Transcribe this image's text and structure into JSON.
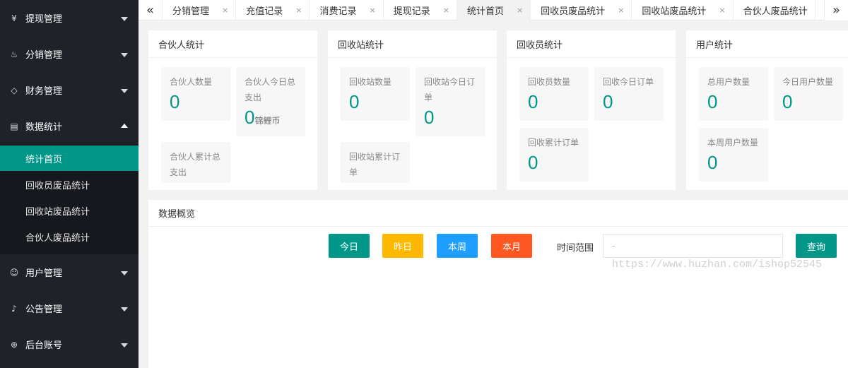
{
  "sidebar": {
    "items": [
      {
        "label": "提现管理",
        "icon": "yen-circle-icon",
        "glyph": "¥"
      },
      {
        "label": "分销管理",
        "icon": "fire-icon",
        "glyph": "♨"
      },
      {
        "label": "财务管理",
        "icon": "diamond-icon",
        "glyph": "◇"
      },
      {
        "label": "数据统计",
        "icon": "report-icon",
        "glyph": "▤"
      },
      {
        "label": "用户管理",
        "icon": "user-icon",
        "glyph": "☺"
      },
      {
        "label": "公告管理",
        "icon": "bell-icon",
        "glyph": "♪"
      },
      {
        "label": "后台账号",
        "icon": "globe-icon",
        "glyph": "⊕"
      }
    ],
    "submenu": [
      "统计首页",
      "回收员废品统计",
      "回收站废品统计",
      "合伙人废品统计"
    ]
  },
  "tabs": {
    "left_arrow": "«",
    "right_arrow": "»",
    "close": "×",
    "items": [
      "分销管理",
      "充值记录",
      "消费记录",
      "提现记录",
      "统计首页",
      "回收员废品统计",
      "回收站废品统计",
      "合伙人废品统计"
    ]
  },
  "cards": {
    "partner": {
      "title": "合伙人统计",
      "count_label": "合伙人数量",
      "count_value": "0",
      "today_label": "合伙人今日总支出",
      "today_value": "0",
      "today_unit": "锦鲤币",
      "total_label": "合伙人累计总支出"
    },
    "station": {
      "title": "回收站统计",
      "count_label": "回收站数量",
      "count_value": "0",
      "today_label": "回收站今日订单",
      "today_value": "0",
      "total_label": "回收站累计订单"
    },
    "collector": {
      "title": "回收员统计",
      "count_label": "回收员数量",
      "count_value": "0",
      "today_label": "回收今日订单",
      "today_value": "0",
      "total_label": "回收累计订单",
      "total_value": "0"
    },
    "user": {
      "title": "用户统计",
      "total_label": "总用户数量",
      "total_value": "0",
      "today_label": "今日用户数量",
      "today_value": "0",
      "week_label": "本周用户数量",
      "week_value": "0"
    }
  },
  "overview": {
    "title": "数据概览",
    "buttons": {
      "today": "今日",
      "yesterday": "昨日",
      "week": "本周",
      "month": "本月",
      "query": "查询"
    },
    "range_label": "时间范围",
    "range_placeholder": "-",
    "watermark": "https://www.huzhan.com/ishop52545"
  },
  "colors": {
    "accent": "#009688",
    "yellow": "#FFB800",
    "blue": "#1E9FFF",
    "orange": "#FF5722",
    "sidebar": "#20222a"
  }
}
